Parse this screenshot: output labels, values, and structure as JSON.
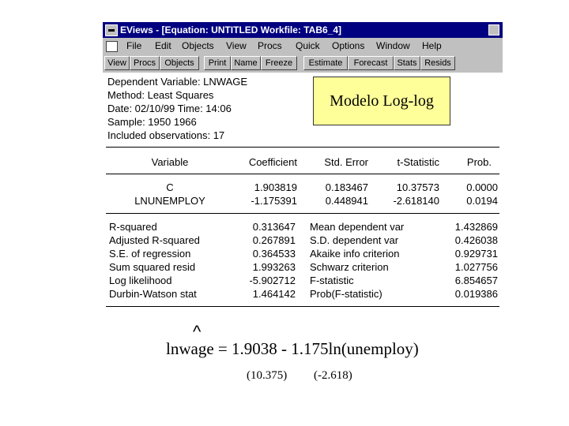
{
  "window": {
    "title": "EViews - [Equation: UNTITLED   Workfile: TAB6_4]",
    "menu": [
      "File",
      "Edit",
      "Objects",
      "View",
      "Procs",
      "Quick",
      "Options",
      "Window",
      "Help"
    ],
    "toolbar": [
      "View",
      "Procs",
      "Objects",
      "Print",
      "Name",
      "Freeze",
      "Estimate",
      "Forecast",
      "Stats",
      "Resids"
    ]
  },
  "header": {
    "dependent": "Dependent Variable: LNWAGE",
    "method": "Method: Least Squares",
    "date": "Date: 02/10/99   Time: 14:06",
    "sample": "Sample: 1950 1966",
    "obs": "Included observations: 17"
  },
  "coef_table": {
    "columns": [
      "Variable",
      "Coefficient",
      "Std. Error",
      "t-Statistic",
      "Prob."
    ],
    "rows": [
      [
        "C",
        "1.903819",
        "0.183467",
        "10.37573",
        "0.0000"
      ],
      [
        "LNUNEMPLOY",
        "-1.175391",
        "0.448941",
        "-2.618140",
        "0.0194"
      ]
    ]
  },
  "stats": {
    "left": [
      [
        "R-squared",
        "0.313647"
      ],
      [
        "Adjusted R-squared",
        "0.267891"
      ],
      [
        "S.E. of regression",
        "0.364533"
      ],
      [
        "Sum squared resid",
        "1.993263"
      ],
      [
        "Log likelihood",
        "-5.902712"
      ],
      [
        "Durbin-Watson stat",
        "1.464142"
      ]
    ],
    "right": [
      [
        "Mean dependent var",
        "1.432869"
      ],
      [
        "S.D. dependent var",
        "0.426038"
      ],
      [
        "Akaike info criterion",
        "0.929731"
      ],
      [
        "Schwarz criterion",
        "1.027756"
      ],
      [
        "F-statistic",
        "6.854657"
      ],
      [
        "Prob(F-statistic)",
        "0.019386"
      ]
    ]
  },
  "callout": "Modelo Log-log",
  "equation": {
    "hat": "^",
    "text": "lnwage = 1.9038 - 1.175ln(unemploy)",
    "t_const": "(10.375)",
    "t_slope": "(-2.618)"
  }
}
